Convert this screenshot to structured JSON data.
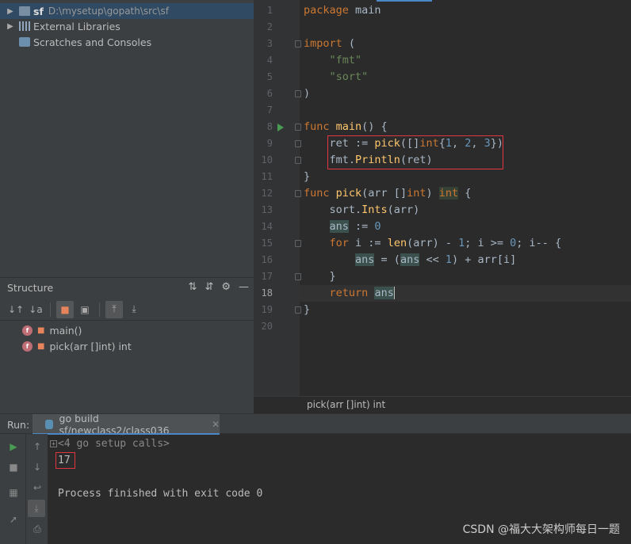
{
  "project": {
    "items": [
      {
        "label": "sf",
        "path": "D:\\mysetup\\gopath\\src\\sf"
      },
      {
        "label": "External Libraries"
      },
      {
        "label": "Scratches and Consoles"
      }
    ]
  },
  "structure": {
    "title": "Structure",
    "items": [
      {
        "label": "main()",
        "badge": "f"
      },
      {
        "label": "pick(arr []int) int",
        "badge": "f"
      }
    ]
  },
  "editor": {
    "line_numbers": [
      "1",
      "2",
      "3",
      "4",
      "5",
      "6",
      "7",
      "8",
      "9",
      "10",
      "11",
      "12",
      "13",
      "14",
      "15",
      "16",
      "17",
      "18",
      "19",
      "20"
    ],
    "current_line": "18",
    "breadcrumb": "pick(arr []int) int"
  },
  "run": {
    "label": "Run:",
    "tab_label": "go build sf/newclass2/class036",
    "collapsed_text": "<4 go setup calls>",
    "output_value": "17",
    "finish_message": "Process finished with exit code 0"
  },
  "watermark": "CSDN @福大大架构师每日一题",
  "colors": {
    "accent": "#4a88c7",
    "highlight_box": "#e0363f",
    "run_green": "#499c54"
  }
}
